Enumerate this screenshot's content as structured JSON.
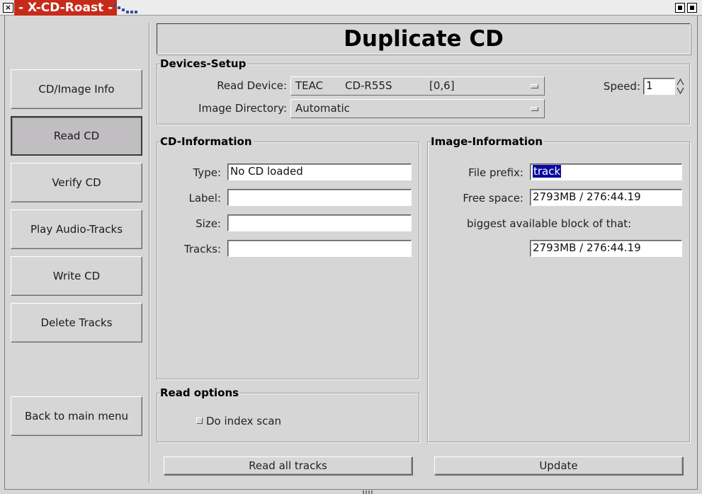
{
  "window": {
    "title": "- X-CD-Roast -",
    "close_glyph": "×"
  },
  "nav": {
    "items": [
      {
        "label": "CD/Image Info"
      },
      {
        "label": "Read CD"
      },
      {
        "label": "Verify CD"
      },
      {
        "label": "Play Audio-Tracks"
      },
      {
        "label": "Write CD"
      },
      {
        "label": "Delete Tracks"
      }
    ],
    "back_label": "Back to main menu",
    "active_item": "Read CD"
  },
  "page_title": "Duplicate CD",
  "devices_setup": {
    "title": "Devices-Setup",
    "read_device_label": "Read Device:",
    "read_device_vendor": "TEAC",
    "read_device_model": "CD-R55S",
    "read_device_id": "[0,6]",
    "image_dir_label": "Image Directory:",
    "image_dir_value": "Automatic",
    "speed_label": "Speed:",
    "speed_value": "1"
  },
  "cd_info": {
    "title": "CD-Information",
    "type_label": "Type:",
    "type_value": "No CD loaded",
    "label_label": "Label:",
    "label_value": "",
    "size_label": "Size:",
    "size_value": "",
    "tracks_label": "Tracks:",
    "tracks_value": ""
  },
  "image_info": {
    "title": "Image-Information",
    "prefix_label": "File prefix:",
    "prefix_value": "track",
    "free_label": "Free space:",
    "free_value": "2793MB / 276:44.19",
    "biggest_label": "biggest available block of that:",
    "biggest_value": "2793MB / 276:44.19"
  },
  "read_options": {
    "title": "Read options",
    "index_scan_label": "Do index scan",
    "index_scan_checked": false
  },
  "actions": {
    "read_all_label": "Read all tracks",
    "update_label": "Update"
  },
  "colors": {
    "background": "#d6d6d6",
    "title_bar_accent": "#c82a1a",
    "selection": "#0a0aa0",
    "active_button": "#c1bec2"
  }
}
